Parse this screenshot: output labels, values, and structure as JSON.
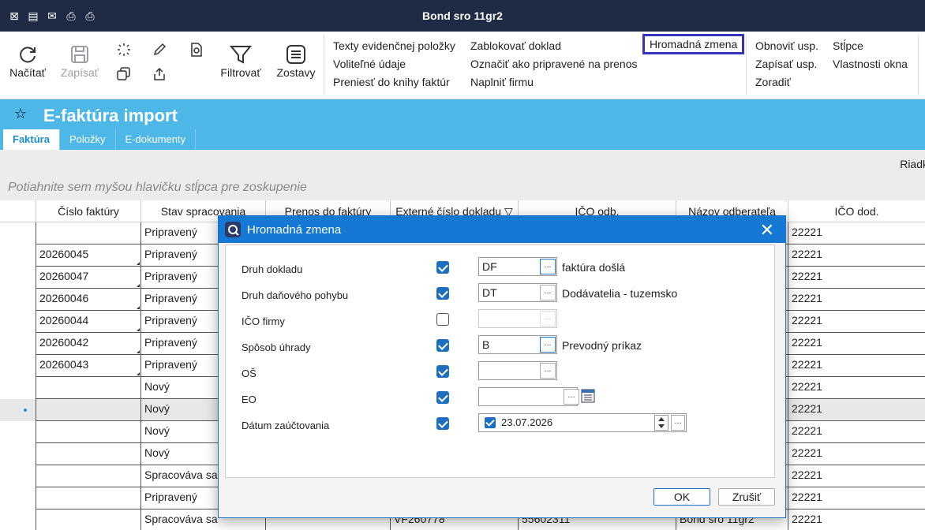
{
  "app": {
    "title": "Bond sro 11gr2"
  },
  "ribbon": {
    "load_label": "Načítať",
    "save_label": "Zapísať",
    "filter_label": "Filtrovať",
    "reports_label": "Zostavy",
    "menu_col1": [
      "Texty evidenčnej položky",
      "Voliteľné údaje",
      "Preniesť do knihy faktúr"
    ],
    "menu_col2": [
      "Zablokovať doklad",
      "Označiť ako pripravené na prenos",
      "Naplniť firmu"
    ],
    "menu_col3_highlight": "Hromadná zmena",
    "menu_col4": [
      "Obnoviť usp.",
      "Zapísať usp.",
      "Zoradiť"
    ],
    "menu_col5": [
      "Stĺpce",
      "Vlastnosti okna"
    ]
  },
  "page": {
    "title": "E-faktúra import",
    "tabs": [
      "Faktúra",
      "Položky",
      "E-dokumenty"
    ],
    "rows_label": "Riadk",
    "group_hint": "Potiahnite sem myšou hlavičku stĺpca pre zoskupenie"
  },
  "grid": {
    "columns": [
      "Číslo faktúry",
      "Stav spracovania",
      "Prenos do faktúry",
      "Externé číslo dokladu ▽",
      "IČO odb.",
      "Názov odberateľa",
      "IČO dod."
    ],
    "rows": [
      [
        "",
        "Pripravený",
        "",
        "",
        "",
        "",
        "22221"
      ],
      [
        "20260045",
        "Pripravený",
        "",
        "",
        "",
        "",
        "22221"
      ],
      [
        "20260047",
        "Pripravený",
        "",
        "",
        "",
        "",
        "22221"
      ],
      [
        "20260046",
        "Pripravený",
        "",
        "",
        "",
        "",
        "22221"
      ],
      [
        "20260044",
        "Pripravený",
        "",
        "",
        "",
        "",
        "22221"
      ],
      [
        "20260042",
        "Pripravený",
        "",
        "",
        "",
        "",
        "22221"
      ],
      [
        "20260043",
        "Pripravený",
        "",
        "",
        "",
        "",
        "22221"
      ],
      [
        "",
        "Nový",
        "",
        "",
        "",
        "",
        "22221"
      ],
      [
        "",
        "Nový",
        "",
        "",
        "",
        "",
        "22221"
      ],
      [
        "",
        "Nový",
        "",
        "",
        "",
        "",
        "22221"
      ],
      [
        "",
        "Nový",
        "",
        "",
        "",
        "",
        "22221"
      ],
      [
        "",
        "Spracováva sa",
        "",
        "",
        "",
        "",
        "22221"
      ],
      [
        "",
        "Pripravený",
        "",
        "",
        "",
        "",
        "22221"
      ],
      [
        "",
        "Spracováva sa",
        "",
        "VF260778",
        "55602311",
        "Bond sro 11gr2",
        "22221"
      ]
    ]
  },
  "dialog": {
    "title": "Hromadná zmena",
    "fields": [
      {
        "label": "Druh dokladu",
        "checked": true,
        "value": "DF",
        "desc": "faktúra došlá"
      },
      {
        "label": "Druh daňového pohybu",
        "checked": true,
        "value": "DT",
        "desc": "Dodávatelia - tuzemsko"
      },
      {
        "label": "IČO firmy",
        "checked": false,
        "value": "",
        "desc": ""
      },
      {
        "label": "Spôsob úhrady",
        "checked": true,
        "value": "B",
        "desc": "Prevodný príkaz"
      },
      {
        "label": "OŠ",
        "checked": true,
        "value": "",
        "desc": ""
      },
      {
        "label": "EO",
        "checked": true,
        "value": "",
        "desc": ""
      },
      {
        "label": "Dátum zaúčtovania",
        "checked": true,
        "value": "23.07.2026",
        "desc": ""
      }
    ],
    "ok_label": "OK",
    "cancel_label": "Zrušiť",
    "ellipsis": "..."
  },
  "colors": {
    "titlebar": "#1f2a44",
    "accent": "#4db8e8",
    "dialog_title": "#1478d4"
  }
}
